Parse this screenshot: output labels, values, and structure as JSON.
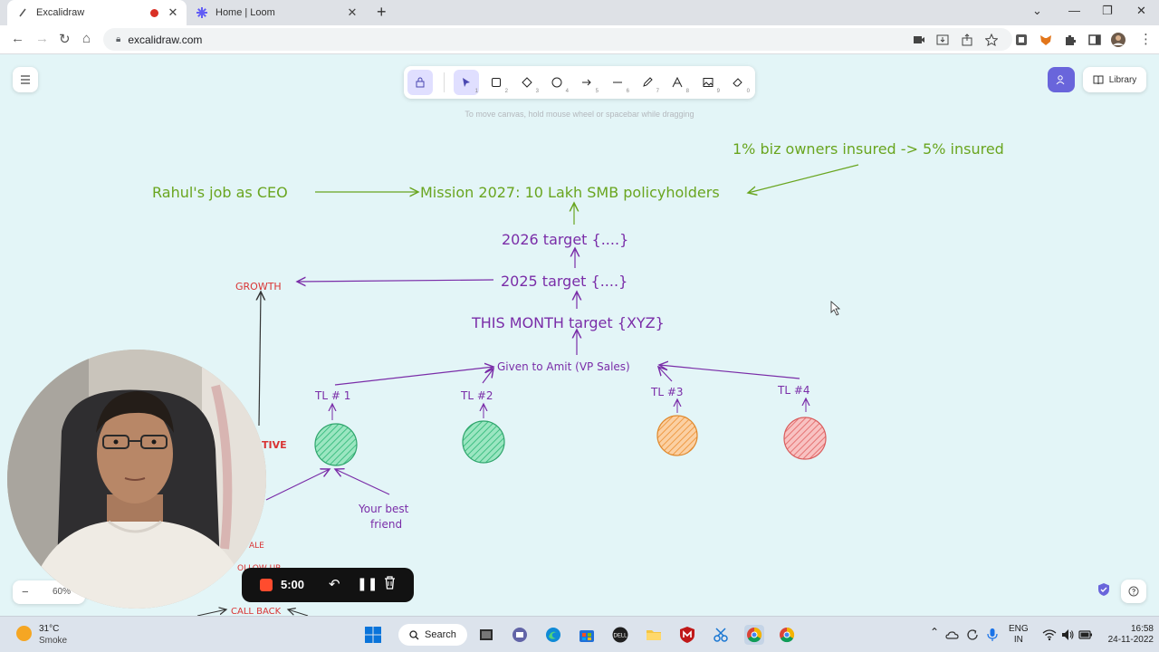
{
  "browser": {
    "tabs": [
      {
        "title": "Excalidraw",
        "recording": true
      },
      {
        "title": "Home | Loom"
      }
    ],
    "url": "excalidraw.com",
    "new_tab": "+",
    "close": "✕"
  },
  "excalidraw": {
    "hint": "To move canvas, hold mouse wheel or spacebar while dragging",
    "library_label": "Library",
    "zoom": "60%",
    "tool_keys": [
      "1",
      "2",
      "3",
      "4",
      "5",
      "6",
      "7",
      "8",
      "9",
      "0"
    ],
    "canvas": {
      "rahul": "Rahul's job as CEO",
      "mission": "Mission 2027: 10 Lakh SMB policyholders",
      "insured": "1% biz owners insured -> 5% insured",
      "t2026": "2026 target {....}",
      "t2025": "2025 target {....}",
      "this_month": "THIS MONTH target {XYZ}",
      "growth": "GROWTH",
      "given_to": "Given to Amit (VP Sales)",
      "tl1": "TL # 1",
      "tl2": "TL #2",
      "tl3": "TL #3",
      "tl4": "TL #4",
      "best_friend_1": "Your best",
      "best_friend_2": "friend",
      "tive": "TIVE",
      "ale": "ALE",
      "follow": "OLLOW UP",
      "call_back": "CALL BACK"
    }
  },
  "loom": {
    "timer": "5:00"
  },
  "taskbar": {
    "temp": "31°C",
    "weather": "Smoke",
    "search": "Search",
    "lang1": "ENG",
    "lang2": "IN",
    "time": "16:58",
    "date": "24-11-2022"
  },
  "colors": {
    "green": "#69a51f",
    "purple": "#7a2da8",
    "red": "#d93434",
    "tl1_fill": "#6ed3a3",
    "tl3_fill": "#f6b26b",
    "tl4_fill": "#f19a9a"
  }
}
